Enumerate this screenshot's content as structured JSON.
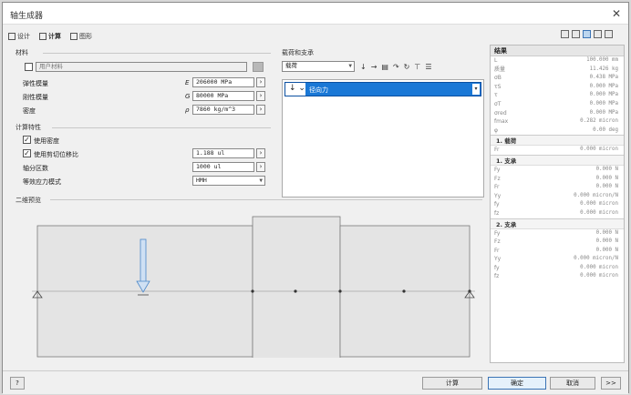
{
  "window": {
    "title": "轴生成器",
    "close": "✕"
  },
  "tabs": [
    {
      "label": "设计"
    },
    {
      "label": "计算"
    },
    {
      "label": "图形"
    }
  ],
  "material": {
    "section": "材料",
    "user_material": "用户材料",
    "rows": [
      {
        "label": "弹性模量",
        "sym": "E",
        "value": "206000 MPa"
      },
      {
        "label": "刚性模量",
        "sym": "G",
        "value": "80000 MPa"
      },
      {
        "label": "密度",
        "sym": "ρ",
        "value": "7860 kg/m^3"
      }
    ]
  },
  "calc_props": {
    "section": "计算特性",
    "use_density": "使用密度",
    "use_shear": "使用剪切位移比",
    "shear_value": "1.188 ul",
    "divisions_label": "轴分区数",
    "divisions_value": "1000 ul",
    "stress_mode_label": "等效应力模式",
    "stress_mode_value": "HMH"
  },
  "loads": {
    "section": "载荷和支承",
    "dropdown": "载荷",
    "item_label": "径向力"
  },
  "preview": {
    "section": "二维预览"
  },
  "results": {
    "header": "结果",
    "rows": [
      {
        "k": "L",
        "v": "100.000 mm"
      },
      {
        "k": "质量",
        "v": "11.426 kg"
      },
      {
        "k": "σB",
        "v": "0.438 MPa"
      },
      {
        "k": "τS",
        "v": "0.000 MPa"
      },
      {
        "k": "τ",
        "v": "0.000 MPa"
      },
      {
        "k": "σT",
        "v": "0.000 MPa"
      },
      {
        "k": "σred",
        "v": "0.000 MPa"
      },
      {
        "k": "fmax",
        "v": "0.282 micron"
      },
      {
        "k": "φ",
        "v": "0.00 deg"
      }
    ],
    "load1_title": "1. 载荷",
    "load1_rows": [
      {
        "k": "Fr",
        "v": "0.000 micron"
      }
    ],
    "sup1_title": "1. 支承",
    "sup1_rows": [
      {
        "k": "Fy",
        "v": "0.000 N"
      },
      {
        "k": "Fz",
        "v": "0.000 N"
      },
      {
        "k": "Fr",
        "v": "0.000 N"
      },
      {
        "k": "Yy",
        "v": "0.000 micron/N"
      },
      {
        "k": "fy",
        "v": "0.000 micron"
      },
      {
        "k": "fz",
        "v": "0.000 micron"
      }
    ],
    "sup2_title": "2. 支承",
    "sup2_rows": [
      {
        "k": "Fy",
        "v": "0.000 N"
      },
      {
        "k": "Fz",
        "v": "0.000 N"
      },
      {
        "k": "Fr",
        "v": "0.000 N"
      },
      {
        "k": "Yy",
        "v": "0.000 micron/N"
      },
      {
        "k": "fy",
        "v": "0.000 micron"
      },
      {
        "k": "fz",
        "v": "0.000 micron"
      }
    ]
  },
  "buttons": {
    "calc": "计算",
    "ok": "确定",
    "cancel": "取消",
    "help": "?",
    "more": ">>"
  },
  "colors": {
    "accent": "#1a78d6",
    "arrow": "#4a86c8"
  }
}
